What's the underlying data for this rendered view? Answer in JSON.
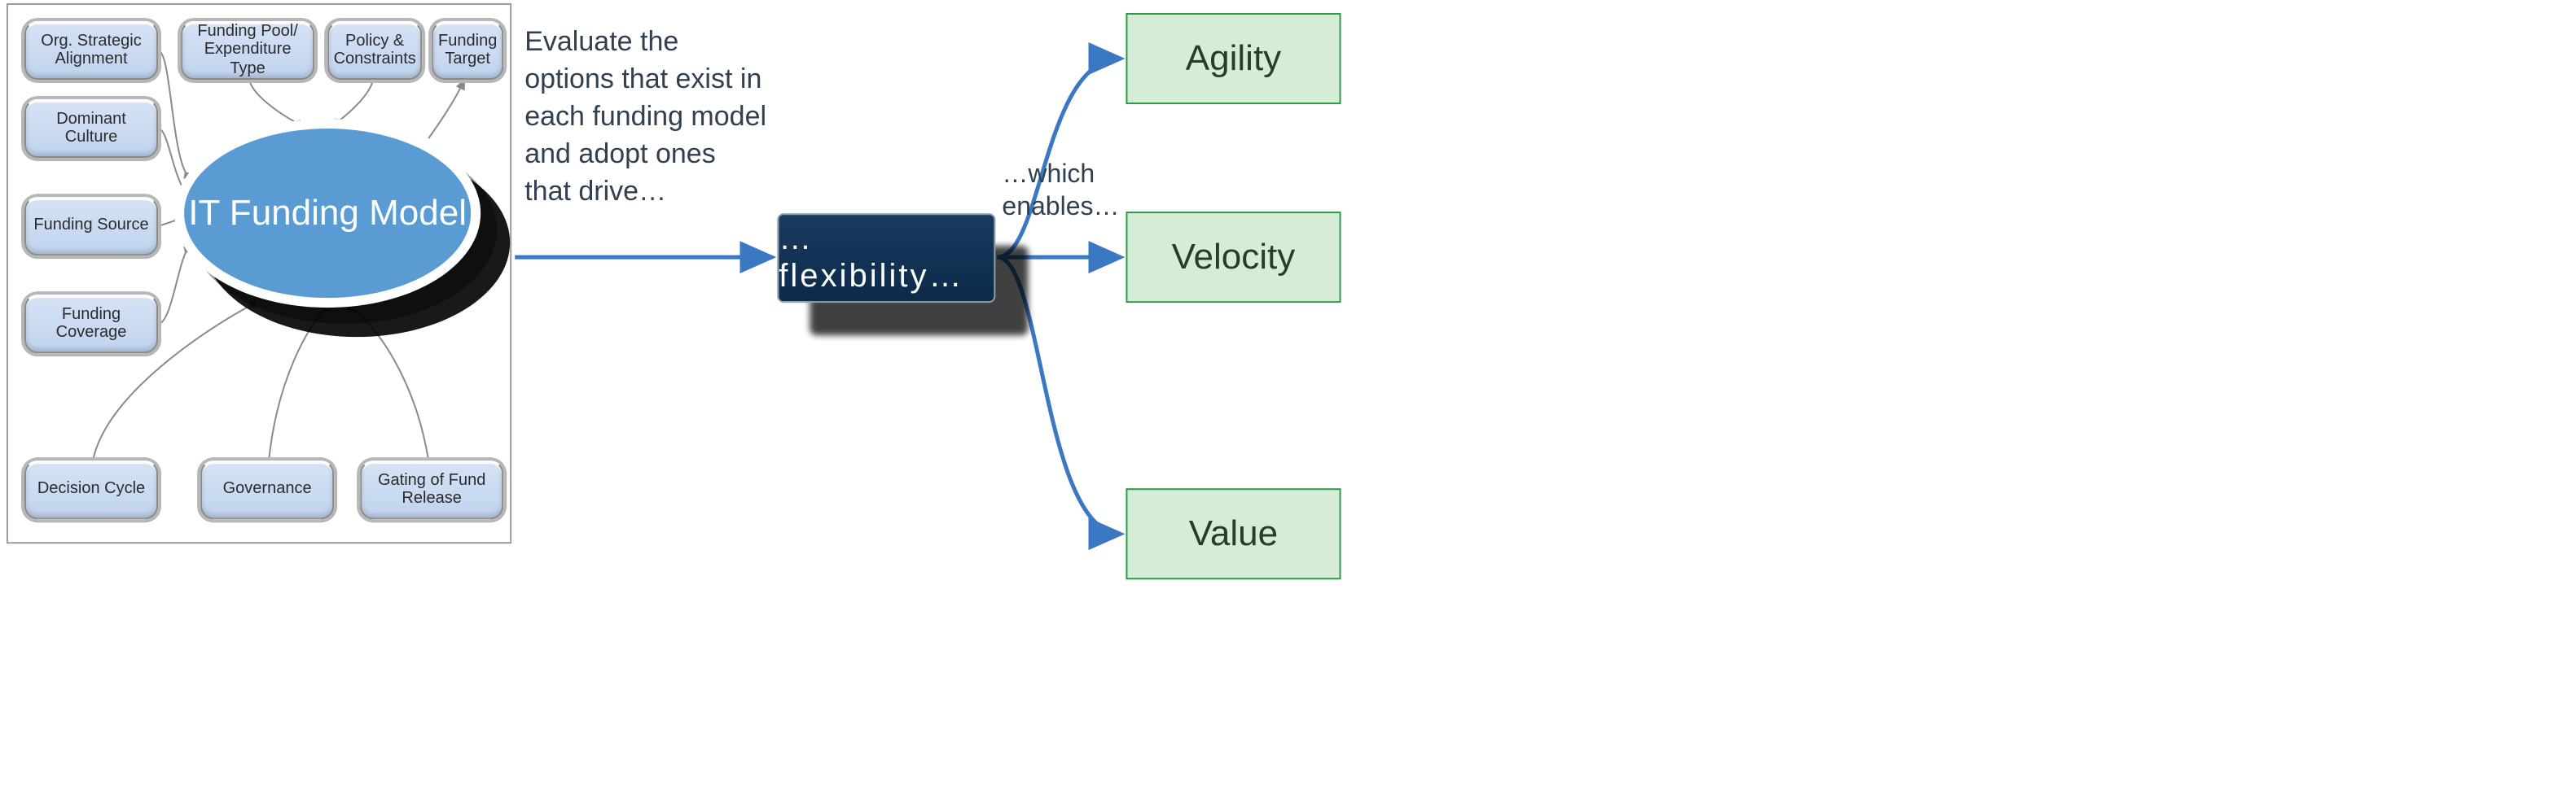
{
  "center_label": "IT Funding Model",
  "chips": {
    "org": "Org. Strategic Alignment",
    "pool": "Funding Pool/ Expenditure Type",
    "policy": "Policy & Constraints",
    "target": "Funding Target",
    "culture": "Dominant Culture",
    "source": "Funding Source",
    "cover": "Funding Coverage",
    "cycle": "Decision Cycle",
    "gov": "Governance",
    "gate": "Gating of Fund Release"
  },
  "middle_text": "Evaluate the options that exist in each funding model and adopt ones that drive…",
  "flex_label": "…flexibility…",
  "enables_label": "…which enables…",
  "outcomes": {
    "agility": "Agility",
    "velocity": "Velocity",
    "value": "Value"
  },
  "colors": {
    "oval": "#5a9bd4",
    "chip_bg": "#cad9ef",
    "flex_bg": "#123a5f",
    "outcome_bg": "#d5edd7",
    "outcome_border": "#2e9a47",
    "arrow_blue": "#3b78c4",
    "grey": "#8a8a8a"
  }
}
